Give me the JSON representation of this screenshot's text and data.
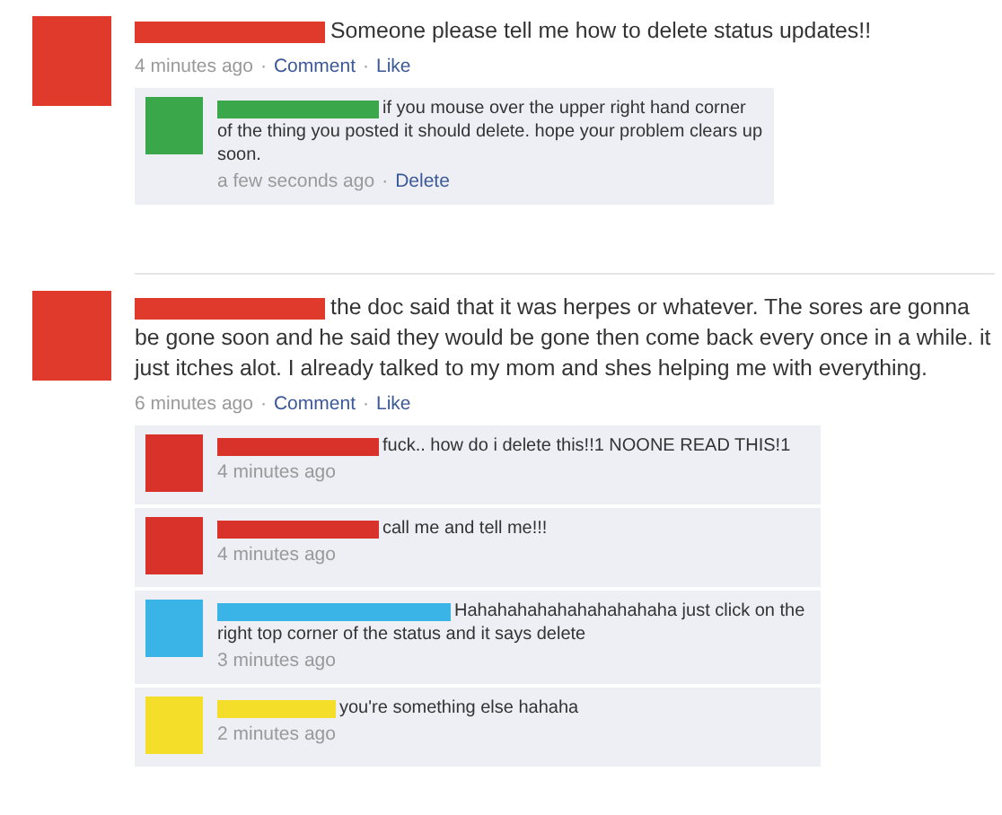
{
  "separator": "·",
  "posts": [
    {
      "color": "#e03a2c",
      "text": "Someone please tell me how to delete status updates!!",
      "time": "4 minutes ago",
      "actions": [
        "Comment",
        "Like"
      ],
      "comments": [
        {
          "color": "#3aa84a",
          "text": "if you mouse over the upper right hand corner of the thing you posted it should delete. hope your problem clears up soon.",
          "time": "a few seconds ago",
          "actions": [
            "Delete"
          ]
        }
      ]
    },
    {
      "color": "#e03a2c",
      "text": "the doc said that it was herpes or whatever. The sores are gonna be gone soon and he said they would be gone then come back every once in a while. it just itches alot. I already talked to my mom and shes helping me with everything.",
      "time": "6 minutes ago",
      "actions": [
        "Comment",
        "Like"
      ],
      "comments": [
        {
          "color": "#d8322a",
          "text": "fuck.. how do i delete this!!1 NOONE READ THIS!1",
          "time": "4 minutes ago"
        },
        {
          "color": "#d8322a",
          "text": "call me and tell me!!!",
          "time": "4 minutes ago"
        },
        {
          "color": "#3ab3e6",
          "text": "Hahahahahahahahahahaha just click on the right top corner of the status and it says delete",
          "time": "3 minutes ago"
        },
        {
          "color": "#f5de2a",
          "text": "you're something else hahaha",
          "time": "2 minutes ago"
        }
      ]
    }
  ]
}
